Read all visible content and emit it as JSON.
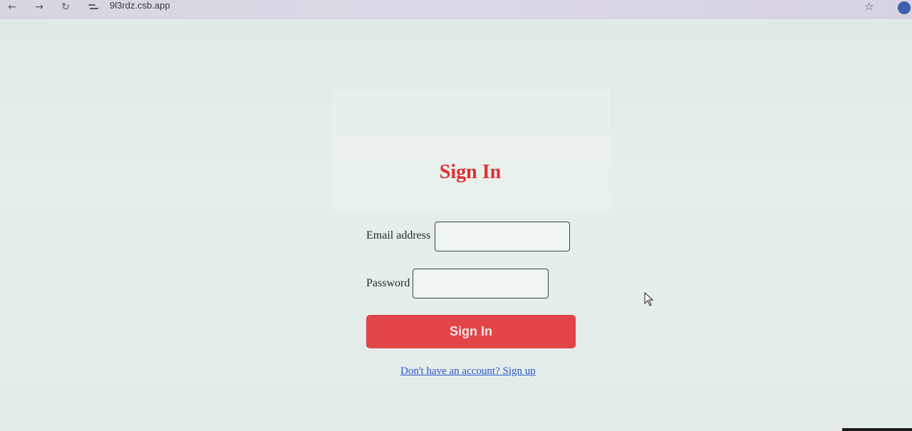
{
  "browser": {
    "url": "9l3rdz.csb.app",
    "icons": {
      "back": "arrow-left-icon",
      "forward": "arrow-right-icon",
      "reload": "reload-icon",
      "site_info": "site-info-icon",
      "bookmark": "star-icon",
      "profile": "profile-avatar"
    }
  },
  "form": {
    "title": "Sign In",
    "email_label": "Email address",
    "email_value": "",
    "password_label": "Password",
    "password_value": "",
    "submit_label": "Sign In",
    "signup_link": "Don't have an account? Sign up"
  },
  "colors": {
    "title": "#e12f33",
    "button_bg": "#e14548",
    "link": "#2b55c9",
    "page_bg": "#e3ece9"
  }
}
